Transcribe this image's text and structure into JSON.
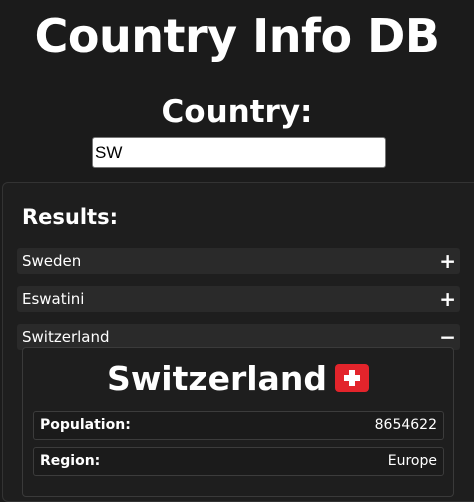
{
  "header": {
    "title": "Country Info DB",
    "country_label": "Country:"
  },
  "search": {
    "value": "SW",
    "placeholder": ""
  },
  "results": {
    "heading": "Results:",
    "items": [
      {
        "name": "Sweden",
        "toggle": "+",
        "expanded": false
      },
      {
        "name": "Eswatini",
        "toggle": "+",
        "expanded": false
      },
      {
        "name": "Switzerland",
        "toggle": "−",
        "expanded": true
      }
    ]
  },
  "detail": {
    "title": "Switzerland",
    "flag_icon": "switzerland-flag-icon",
    "rows": [
      {
        "key": "Population:",
        "value": "8654622"
      },
      {
        "key": "Region:",
        "value": "Europe"
      }
    ]
  },
  "colors": {
    "background": "#1b1b1b",
    "panel": "#1e1e1e",
    "accordion": "#2a2a2a",
    "text": "#ffffff",
    "flag_red": "#e3242b"
  }
}
